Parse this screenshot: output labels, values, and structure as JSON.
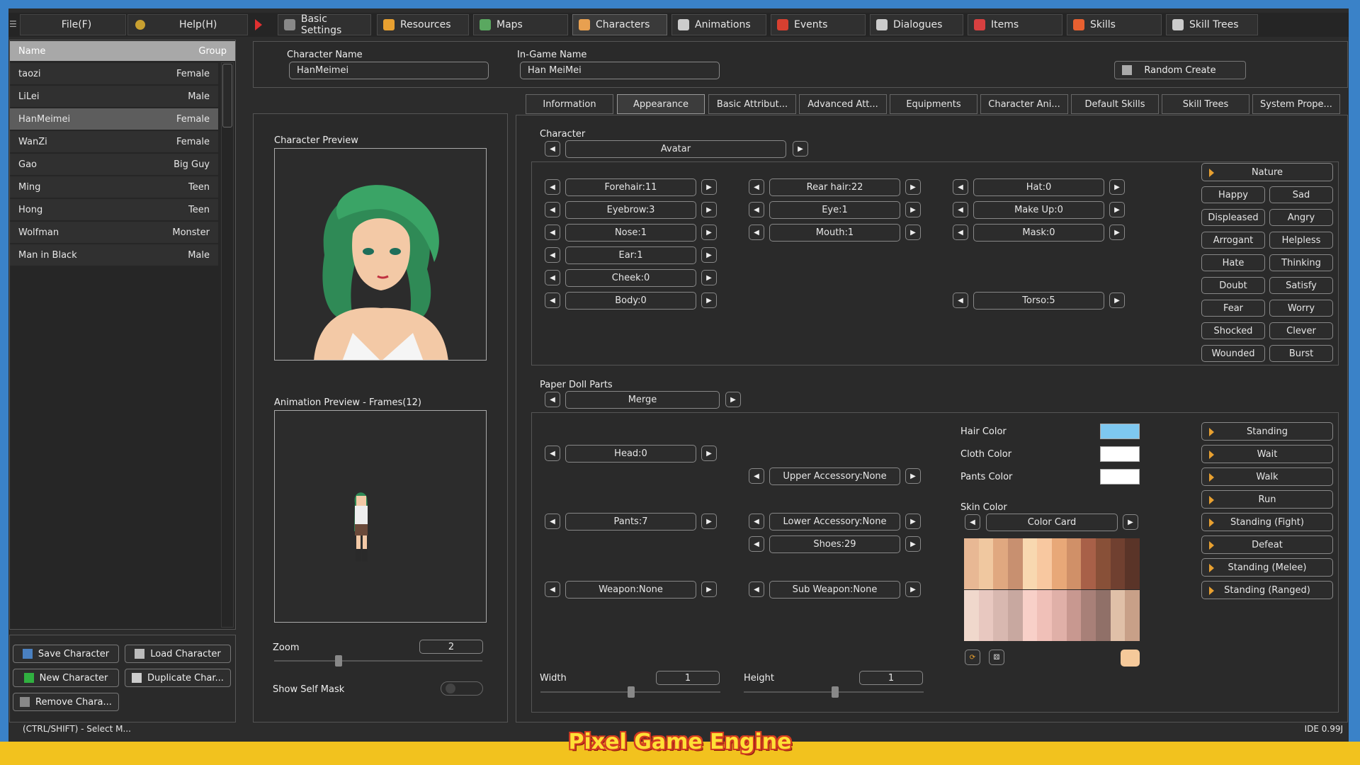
{
  "menus": {
    "file": "File(F)",
    "help": "Help(H)"
  },
  "top_tabs": [
    {
      "label": "Basic Settings",
      "icon": "gear-icon",
      "color": "#888888"
    },
    {
      "label": "Resources",
      "icon": "folder-icon",
      "color": "#e8a030"
    },
    {
      "label": "Maps",
      "icon": "map-icon",
      "color": "#5aa860"
    },
    {
      "label": "Characters",
      "icon": "character-icon",
      "color": "#e8a050"
    },
    {
      "label": "Animations",
      "icon": "animation-icon",
      "color": "#cccccc"
    },
    {
      "label": "Events",
      "icon": "event-icon",
      "color": "#d84030"
    },
    {
      "label": "Dialogues",
      "icon": "dialogue-icon",
      "color": "#cccccc"
    },
    {
      "label": "Items",
      "icon": "potion-icon",
      "color": "#d84040"
    },
    {
      "label": "Skills",
      "icon": "fire-icon",
      "color": "#e86030"
    },
    {
      "label": "Skill Trees",
      "icon": "skilltree-icon",
      "color": "#cccccc"
    }
  ],
  "char_list": {
    "header": {
      "name": "Name",
      "group": "Group"
    },
    "rows": [
      {
        "name": "taozi",
        "group": "Female"
      },
      {
        "name": "LiLei",
        "group": "Male"
      },
      {
        "name": "HanMeimei",
        "group": "Female"
      },
      {
        "name": "WanZi",
        "group": "Female"
      },
      {
        "name": "Gao",
        "group": "Big Guy"
      },
      {
        "name": "Ming",
        "group": "Teen"
      },
      {
        "name": "Hong",
        "group": "Teen"
      },
      {
        "name": "Wolfman",
        "group": "Monster"
      },
      {
        "name": "Man in Black",
        "group": "Male"
      }
    ]
  },
  "buttons": {
    "save": "Save Character",
    "load": "Load Character",
    "new": "New Character",
    "duplicate": "Duplicate Char...",
    "remove": "Remove Chara..."
  },
  "status": "(CTRL/SHIFT) - Select M...",
  "version": "IDE 0.99J",
  "brand": "Pixel Game Engine",
  "header_fields": {
    "char_name_label": "Character Name",
    "char_name_value": "HanMeimei",
    "ingame_label": "In-Game Name",
    "ingame_value": "Han MeiMei",
    "random": "Random Create"
  },
  "preview": {
    "char_preview": "Character Preview",
    "anim_preview": "Animation Preview - Frames(12)",
    "zoom_label": "Zoom",
    "zoom_value": "2",
    "self_mask": "Show Self Mask"
  },
  "subtabs": [
    "Information",
    "Appearance",
    "Basic Attribut...",
    "Advanced Att...",
    "Equipments",
    "Character Ani...",
    "Default Skills",
    "Skill Trees",
    "System Prope..."
  ],
  "appearance": {
    "character_label": "Character",
    "character_value": "Avatar",
    "col1": [
      "Forehair:11",
      "Eyebrow:3",
      "Nose:1",
      "Ear:1",
      "Cheek:0",
      "Body:0"
    ],
    "col2": [
      "Rear hair:22",
      "Eye:1",
      "Mouth:1"
    ],
    "col3": [
      "Hat:0",
      "Make Up:0",
      "Mask:0"
    ],
    "torso": "Torso:5",
    "nature": "Nature",
    "emotions": [
      "Happy",
      "Sad",
      "Displeased",
      "Angry",
      "Arrogant",
      "Helpless",
      "Hate",
      "Thinking",
      "Doubt",
      "Satisfy",
      "Fear",
      "Worry",
      "Shocked",
      "Clever",
      "Wounded",
      "Burst"
    ]
  },
  "paper_doll": {
    "label": "Paper Doll Parts",
    "merge": "Merge",
    "head": "Head:0",
    "upper": "Upper Accessory:None",
    "pants": "Pants:7",
    "lower": "Lower Accessory:None",
    "shoes": "Shoes:29",
    "weapon": "Weapon:None",
    "sub_weapon": "Sub Weapon:None",
    "hair_color_label": "Hair Color",
    "hair_color": "#7ec8f0",
    "cloth_color_label": "Cloth Color",
    "cloth_color": "#ffffff",
    "pants_color_label": "Pants Color",
    "pants_color": "#ffffff",
    "skin_color_label": "Skin Color",
    "color_card": "Color Card",
    "selected_skin": "#f5c99a",
    "width_label": "Width",
    "width_value": "1",
    "height_label": "Height",
    "height_value": "1",
    "animations": [
      "Standing",
      "Wait",
      "Walk",
      "Run",
      "Standing (Fight)",
      "Defeat",
      "Standing (Melee)",
      "Standing (Ranged)"
    ]
  },
  "skin_palette": [
    "#e8b894",
    "#f0c8a0",
    "#e0a880",
    "#c89070",
    "#f8d8b0",
    "#f8c8a0",
    "#e8a878",
    "#d09068",
    "#a86048",
    "#885038",
    "#704030",
    "#5a3428",
    "#f0d8cc",
    "#e8c8c0",
    "#d8b8b0",
    "#c8a8a0",
    "#f8d0c8",
    "#f0c0b8",
    "#e0b0a8",
    "#c89890",
    "#a88078",
    "#907068",
    "#e0c0a8",
    "#c8a088"
  ]
}
